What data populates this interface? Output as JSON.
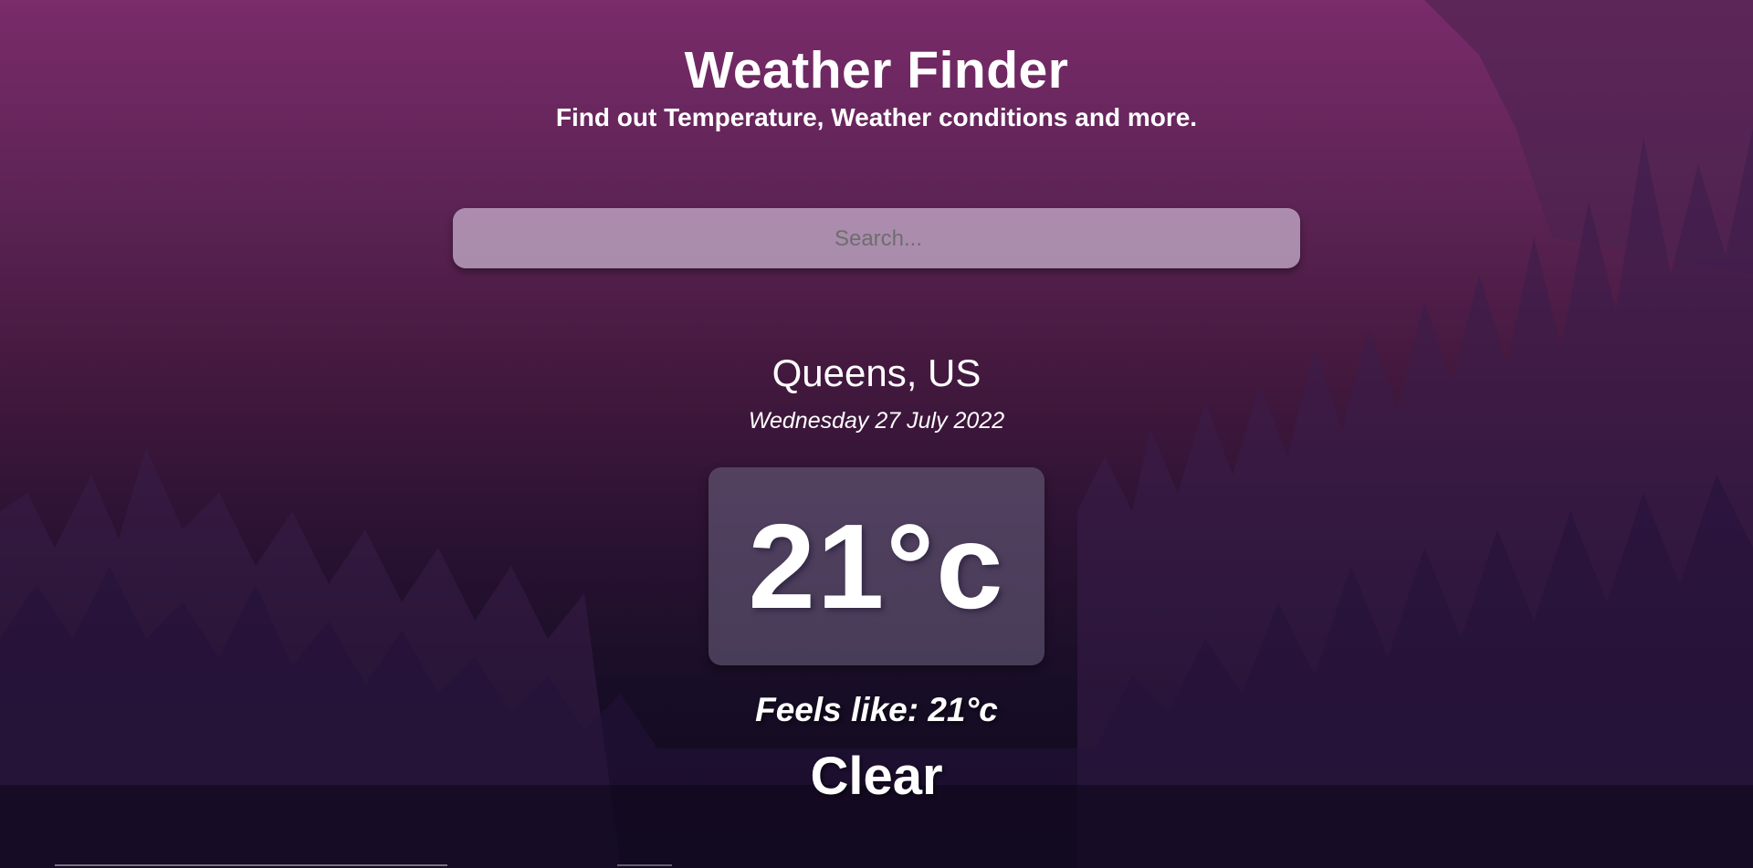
{
  "header": {
    "title": "Weather Finder",
    "subtitle": "Find out Temperature, Weather conditions and more."
  },
  "search": {
    "placeholder": "Search...",
    "value": ""
  },
  "weather": {
    "location": "Queens, US",
    "date": "Wednesday 27 July 2022",
    "temperature": "21°c",
    "feels_like": "Feels like: 21°c",
    "condition": "Clear"
  },
  "colors": {
    "background_top": "#7a2b6a",
    "background_bottom": "#100a1c",
    "tree_silhouette": "#3a1e4a",
    "text": "#ffffff"
  }
}
